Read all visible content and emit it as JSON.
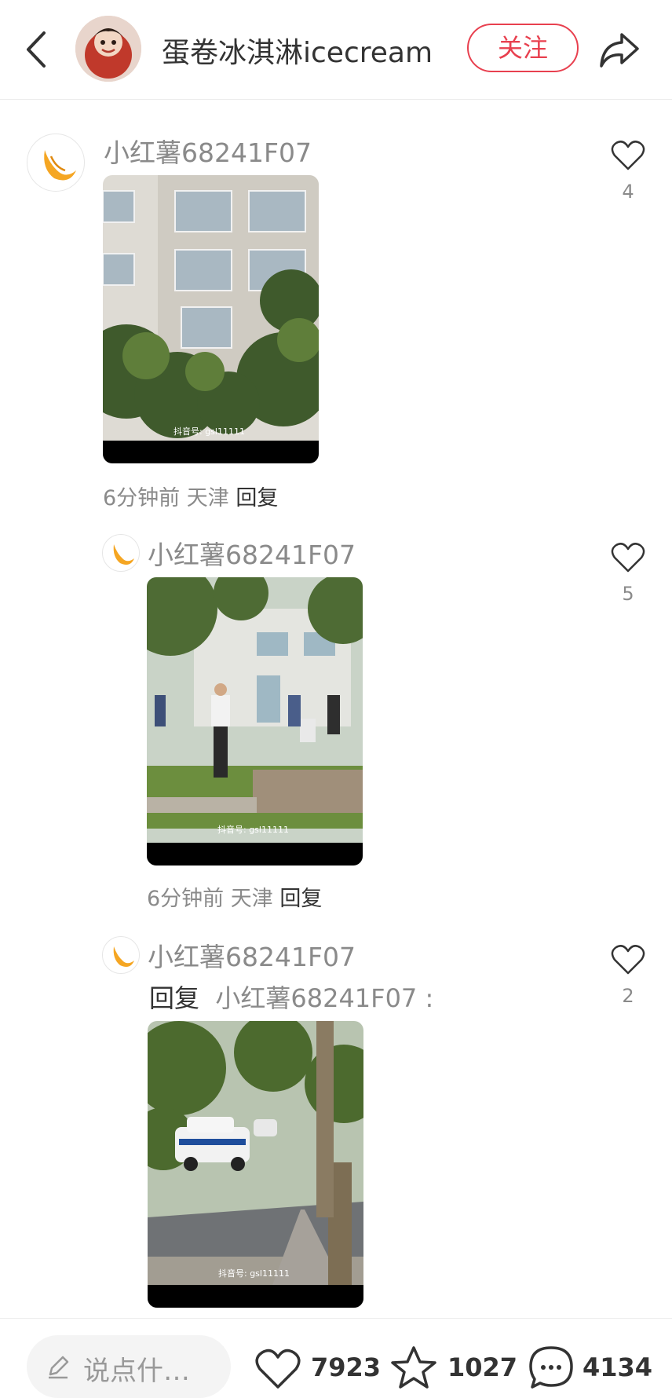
{
  "header": {
    "title": "蛋卷冰淇淋icecream",
    "follow_label": "关注",
    "icons": [
      "back-arrow-icon",
      "share-icon"
    ]
  },
  "comments": [
    {
      "username": "小红薯68241F07",
      "likes": "4",
      "time": "6分钟前",
      "location": "天津",
      "reply_label": "回复",
      "image_watermark": "抖音号: gsl11111"
    },
    {
      "username": "小红薯68241F07",
      "likes": "5",
      "time": "6分钟前",
      "location": "天津",
      "reply_label": "回复",
      "image_watermark": "抖音号: gsl11111"
    },
    {
      "username": "小红薯68241F07",
      "likes": "2",
      "reply_prefix": "回复",
      "reply_to": "小红薯68241F07 :",
      "image_watermark": "抖音号: gsl11111"
    }
  ],
  "bottom_bar": {
    "input_placeholder": "说点什…",
    "like_count": "7923",
    "star_count": "1027",
    "comment_count": "4134"
  },
  "colors": {
    "accent": "#e8404f",
    "text_primary": "#333333",
    "text_secondary": "#8a8a8a"
  }
}
